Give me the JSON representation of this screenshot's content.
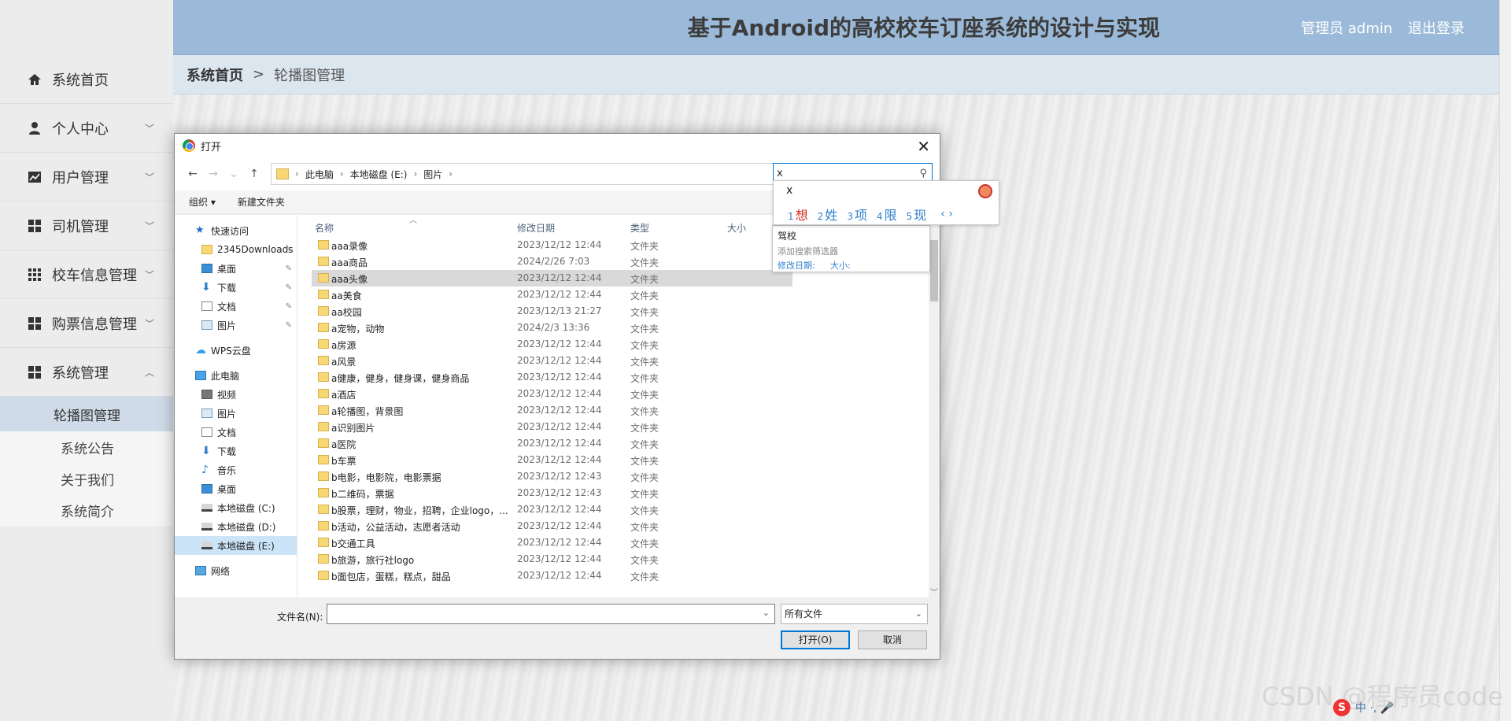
{
  "header": {
    "title": "基于Android的高校校车订座系统的设计与实现",
    "user": "管理员 admin",
    "logout": "退出登录"
  },
  "breadcrumb": {
    "home": "系统首页",
    "separator": ">",
    "current": "轮播图管理"
  },
  "sidebar": {
    "items": [
      {
        "label": "系统首页",
        "icon": "home-icon"
      },
      {
        "label": "个人中心",
        "icon": "user-icon"
      },
      {
        "label": "用户管理",
        "icon": "chart-icon"
      },
      {
        "label": "司机管理",
        "icon": "grid-icon"
      },
      {
        "label": "校车信息管理",
        "icon": "grid9-icon"
      },
      {
        "label": "购票信息管理",
        "icon": "grid-icon"
      },
      {
        "label": "系统管理",
        "icon": "grid-icon"
      }
    ],
    "submenu": [
      "轮播图管理",
      "系统公告",
      "关于我们",
      "系统简介"
    ]
  },
  "dialog": {
    "title": "打开",
    "path": [
      "此电脑",
      "本地磁盘 (E:)",
      "图片"
    ],
    "search_value": "x",
    "toolbar": {
      "organize": "组织 ▾",
      "new_folder": "新建文件夹"
    },
    "nav": {
      "quick": "快速访问",
      "quick_items": [
        "2345Downloads",
        "桌面",
        "下载",
        "文档",
        "图片"
      ],
      "wps": "WPS云盘",
      "pc": "此电脑",
      "pc_items": [
        "视频",
        "图片",
        "文档",
        "下载",
        "音乐",
        "桌面",
        "本地磁盘 (C:)",
        "本地磁盘 (D:)",
        "本地磁盘 (E:)"
      ],
      "network": "网络"
    },
    "columns": {
      "name": "名称",
      "date": "修改日期",
      "type": "类型",
      "size": "大小"
    },
    "files": [
      {
        "name": "aaa录像",
        "date": "2023/12/12 12:44",
        "type": "文件夹"
      },
      {
        "name": "aaa商品",
        "date": "2024/2/26 7:03",
        "type": "文件夹"
      },
      {
        "name": "aaa头像",
        "date": "2023/12/12 12:44",
        "type": "文件夹"
      },
      {
        "name": "aa美食",
        "date": "2023/12/12 12:44",
        "type": "文件夹"
      },
      {
        "name": "aa校园",
        "date": "2023/12/13 21:27",
        "type": "文件夹"
      },
      {
        "name": "a宠物，动物",
        "date": "2024/2/3 13:36",
        "type": "文件夹"
      },
      {
        "name": "a房源",
        "date": "2023/12/12 12:44",
        "type": "文件夹"
      },
      {
        "name": "a风景",
        "date": "2023/12/12 12:44",
        "type": "文件夹"
      },
      {
        "name": "a健康，健身，健身课，健身商品",
        "date": "2023/12/12 12:44",
        "type": "文件夹"
      },
      {
        "name": "a酒店",
        "date": "2023/12/12 12:44",
        "type": "文件夹"
      },
      {
        "name": "a轮播图，背景图",
        "date": "2023/12/12 12:44",
        "type": "文件夹"
      },
      {
        "name": "a识别图片",
        "date": "2023/12/12 12:44",
        "type": "文件夹"
      },
      {
        "name": "a医院",
        "date": "2023/12/12 12:44",
        "type": "文件夹"
      },
      {
        "name": "b车票",
        "date": "2023/12/12 12:44",
        "type": "文件夹"
      },
      {
        "name": "b电影，电影院，电影票据",
        "date": "2023/12/12 12:43",
        "type": "文件夹"
      },
      {
        "name": "b二维码，票据",
        "date": "2023/12/12 12:43",
        "type": "文件夹"
      },
      {
        "name": "b股票，理财，物业，招聘，企业logo，...",
        "date": "2023/12/12 12:44",
        "type": "文件夹"
      },
      {
        "name": "b活动，公益活动，志愿者活动",
        "date": "2023/12/12 12:44",
        "type": "文件夹"
      },
      {
        "name": "b交通工具",
        "date": "2023/12/12 12:44",
        "type": "文件夹"
      },
      {
        "name": "b旅游，旅行社logo",
        "date": "2023/12/12 12:44",
        "type": "文件夹"
      },
      {
        "name": "b面包店，蛋糕，糕点，甜品",
        "date": "2023/12/12 12:44",
        "type": "文件夹"
      }
    ],
    "filename_label": "文件名(N):",
    "filetype": "所有文件",
    "open_btn": "打开(O)",
    "cancel_btn": "取消"
  },
  "ime": {
    "typed": "x",
    "candidates": [
      {
        "n": "1",
        "t": "想"
      },
      {
        "n": "2",
        "t": "姓"
      },
      {
        "n": "3",
        "t": "项"
      },
      {
        "n": "4",
        "t": "限"
      },
      {
        "n": "5",
        "t": "现"
      }
    ],
    "nav": "‹ ›"
  },
  "suggest": {
    "item": "驾校",
    "add_filter": "添加搜索筛选器",
    "date_filter": "修改日期:",
    "size_filter": "大小:"
  },
  "watermark": "CSDN @程序员code",
  "tray_text": "中 ·, 🎤"
}
